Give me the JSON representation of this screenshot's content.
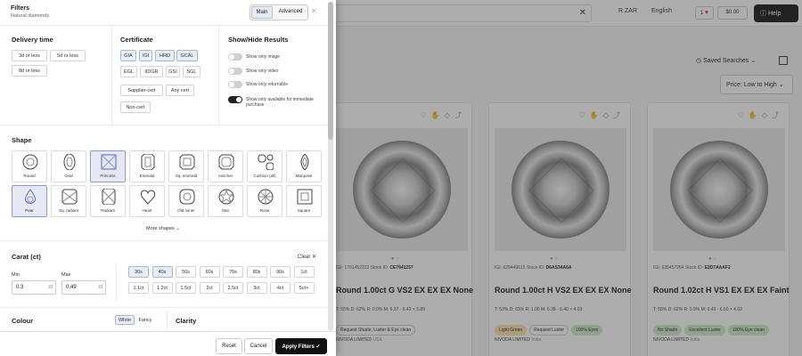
{
  "background": {
    "search": {
      "clear_glyph": "✕"
    },
    "topbar": {
      "currency": "R ZAR",
      "language": "English",
      "wishlist_count": "1",
      "cart_total": "$0.00",
      "help_label": "Help"
    },
    "saved_searches": "Saved Searches",
    "sort_label": "Price: Low to High",
    "cards": [
      {
        "kind": "IGI: 1701452222",
        "stock": "CE7641257",
        "title": "Round 1.00ct G VS2 EX EX EX None",
        "stats": "T: 55%   D: 62%   R: 0.0%   M: 6.37 - 6.42 × 3.89",
        "tags": [
          {
            "text": "Request Shade, Luster & Eye clean",
            "tone": "plain"
          }
        ],
        "seller": "NIVODA LIMITED",
        "country": "USA"
      },
      {
        "kind": "IGI: 629449615",
        "stock": "D6AS34A6A",
        "title": "Round 1.00ct H VS2 EX EX EX None",
        "stats": "T: 53%   D: 63%   R: 1.00   M: 6.38 - 6.40 × 4.03",
        "tags": [
          {
            "text": "Light Green",
            "tone": "yellow"
          },
          {
            "text": "Request Luster",
            "tone": "plain"
          },
          {
            "text": "100% Eyes",
            "tone": "green"
          }
        ],
        "seller": "NIVODA LIMITED",
        "country": "India"
      },
      {
        "kind": "IGI: 635457264",
        "stock": "E2D7AAAF2",
        "title": "Round 1.02ct H VS1 EX EX EX Faint",
        "stats": "T: 58%   D: 62%   R: 0.9%   M: 6.43 - 6.50 × 4.02",
        "tags": [
          {
            "text": "No Shade",
            "tone": "green"
          },
          {
            "text": "Excellent Luster",
            "tone": "green"
          },
          {
            "text": "100% Eye clean",
            "tone": "green"
          }
        ],
        "seller": "NIVODA LIMITED",
        "country": "India"
      }
    ],
    "card_labels": {
      "stock_prefix": "Stock ID:"
    }
  },
  "filters": {
    "title": "Filters",
    "subtitle": "Natural diamonds",
    "modes": [
      "Main",
      "Advanced"
    ],
    "close_glyph": "✕",
    "delivery": {
      "heading": "Delivery time",
      "options": [
        "3d or less",
        "5d or less",
        "8d or less"
      ]
    },
    "certificate": {
      "heading": "Certificate",
      "options": [
        "GIA",
        "IGI",
        "HRD",
        "GCAL",
        "EGL",
        "IIDGR",
        "GSI",
        "SGL",
        "Supplier-cert",
        "Any cert",
        "Non-cert"
      ],
      "selected": [
        "GIA",
        "IGI",
        "HRD",
        "GCAL"
      ]
    },
    "results": {
      "heading": "Show/Hide Results",
      "toggles": [
        {
          "label": "Show only image",
          "on": false
        },
        {
          "label": "Show only video",
          "on": false
        },
        {
          "label": "Show only returnable",
          "on": false
        },
        {
          "label": "Show only available for immediate purchase",
          "on": true
        }
      ]
    },
    "shape": {
      "heading": "Shape",
      "items": [
        "Round",
        "Oval",
        "Princess",
        "Emerald",
        "Sq. emerald",
        "Asscher",
        "Cushion (all)",
        "Marquise",
        "Pear",
        "Sq. radiant",
        "Radiant",
        "Heart",
        "Old miner",
        "Star",
        "Rose",
        "Square"
      ],
      "selected": [
        "Princess",
        "Pear"
      ],
      "more": "More shapes"
    },
    "carat": {
      "heading": "Carat (ct)",
      "clear": "Clear",
      "min_label": "Min",
      "max_label": "Max",
      "min": "0.3",
      "max": "0.49",
      "unit": "ct",
      "ranges": [
        "30s",
        "40s",
        "50s",
        "60s",
        "70s",
        "80s",
        "90s",
        "1ct",
        "1.1ct",
        "1.2ct",
        "1.5ct",
        "2ct",
        "2.5ct",
        "3ct",
        "4ct",
        "5ct+"
      ],
      "selected": [
        "30s",
        "40s"
      ]
    },
    "colour": {
      "heading": "Colour",
      "modes": [
        "White",
        "Fancy"
      ]
    },
    "clarity": {
      "heading": "Clarity"
    },
    "footer": {
      "reset": "Reset",
      "cancel": "Cancel",
      "apply": "Apply Filters",
      "apply_glyph": "✓"
    }
  }
}
